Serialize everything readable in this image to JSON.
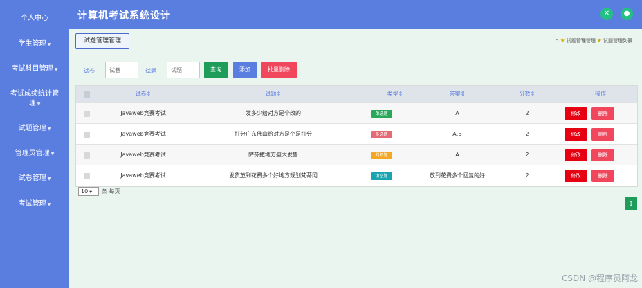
{
  "app": {
    "title": "计算机考试系统设计"
  },
  "sidebar": {
    "items": [
      {
        "label": "个人中心",
        "caret": false
      },
      {
        "label": "学生管理",
        "caret": true
      },
      {
        "label": "考试科目管理",
        "caret": true
      },
      {
        "label": "考试成绩统计管理",
        "label_line1": "考试成绩统计管",
        "label_line2": "理",
        "caret": true
      },
      {
        "label": "试题管理",
        "caret": true
      },
      {
        "label": "管理员管理",
        "caret": true
      },
      {
        "label": "试卷管理",
        "caret": true
      },
      {
        "label": "考试管理",
        "caret": true
      }
    ]
  },
  "header": {
    "icons": [
      "fullscreen-icon",
      "user-icon"
    ]
  },
  "page": {
    "tag": "试题管理管理"
  },
  "breadcrumb": {
    "home_icon": "home-icon",
    "items": [
      "试题管理管理",
      "试题管理列表"
    ]
  },
  "filters": {
    "paper_label": "试卷",
    "paper_placeholder": "试卷",
    "question_label": "试题",
    "question_placeholder": "试题",
    "search_button": "查询",
    "add_button": "添加",
    "batch_delete_button": "批量删除"
  },
  "table": {
    "columns": [
      "试卷",
      "试题",
      "类型",
      "答案",
      "分数",
      "操作"
    ],
    "rows": [
      {
        "paper": "Javaweb竞赛考试",
        "question": "发多少给对方是个改的",
        "type": "单选题",
        "answer": "A",
        "score": "2"
      },
      {
        "paper": "Javaweb竞赛考试",
        "question": "打分广东佛山给对方是个是打分",
        "type": "多选题",
        "answer": "A,B",
        "score": "2"
      },
      {
        "paper": "Javaweb竞赛考试",
        "question": "萨芬撒地方盛大发售",
        "type": "判断题",
        "answer": "A",
        "score": "2"
      },
      {
        "paper": "Javaweb竞赛考试",
        "question": "发货放到花费多个好地方规划梵蒂冈",
        "type": "填空题",
        "answer": "放到花费多个回复的好",
        "score": "2"
      }
    ],
    "edit_label": "修改",
    "delete_label": "删除"
  },
  "pagination": {
    "page_size": "10",
    "per_page_label": "条 每页",
    "current_page": "1"
  },
  "watermark": "CSDN @程序员阿龙",
  "colors": {
    "sidebar": "#5a7de0",
    "content_bg": "#e9f5ee",
    "search": "#1e9c59",
    "add": "#5a7de0",
    "batch_delete": "#f0475d",
    "edit": "#e60012",
    "delete": "#f0475d",
    "badge_single": "#2aa85a",
    "badge_multi": "#e46a73",
    "badge_judge": "#f5a623",
    "badge_fill": "#1aa4b0"
  }
}
